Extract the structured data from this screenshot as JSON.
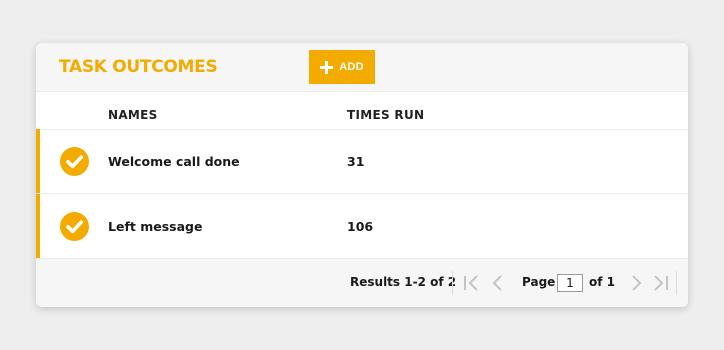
{
  "card": {
    "title": "TASK OUTCOMES",
    "add_button_label": "ADD"
  },
  "table": {
    "columns": [
      "NAMES",
      "TIMES RUN"
    ],
    "rows": [
      {
        "name": "Welcome call done",
        "times_run": "31",
        "status_icon": "check-circle-icon"
      },
      {
        "name": "Left message",
        "times_run": "106",
        "status_icon": "check-circle-icon"
      }
    ]
  },
  "pagination": {
    "results": "Results 1-2 of 2",
    "page_label": "Page",
    "current_page": "1",
    "of_label": "of 1"
  },
  "colors": {
    "accent": "#f4ab00",
    "background": "#eeeeee",
    "header_bg": "#f6f6f6"
  }
}
